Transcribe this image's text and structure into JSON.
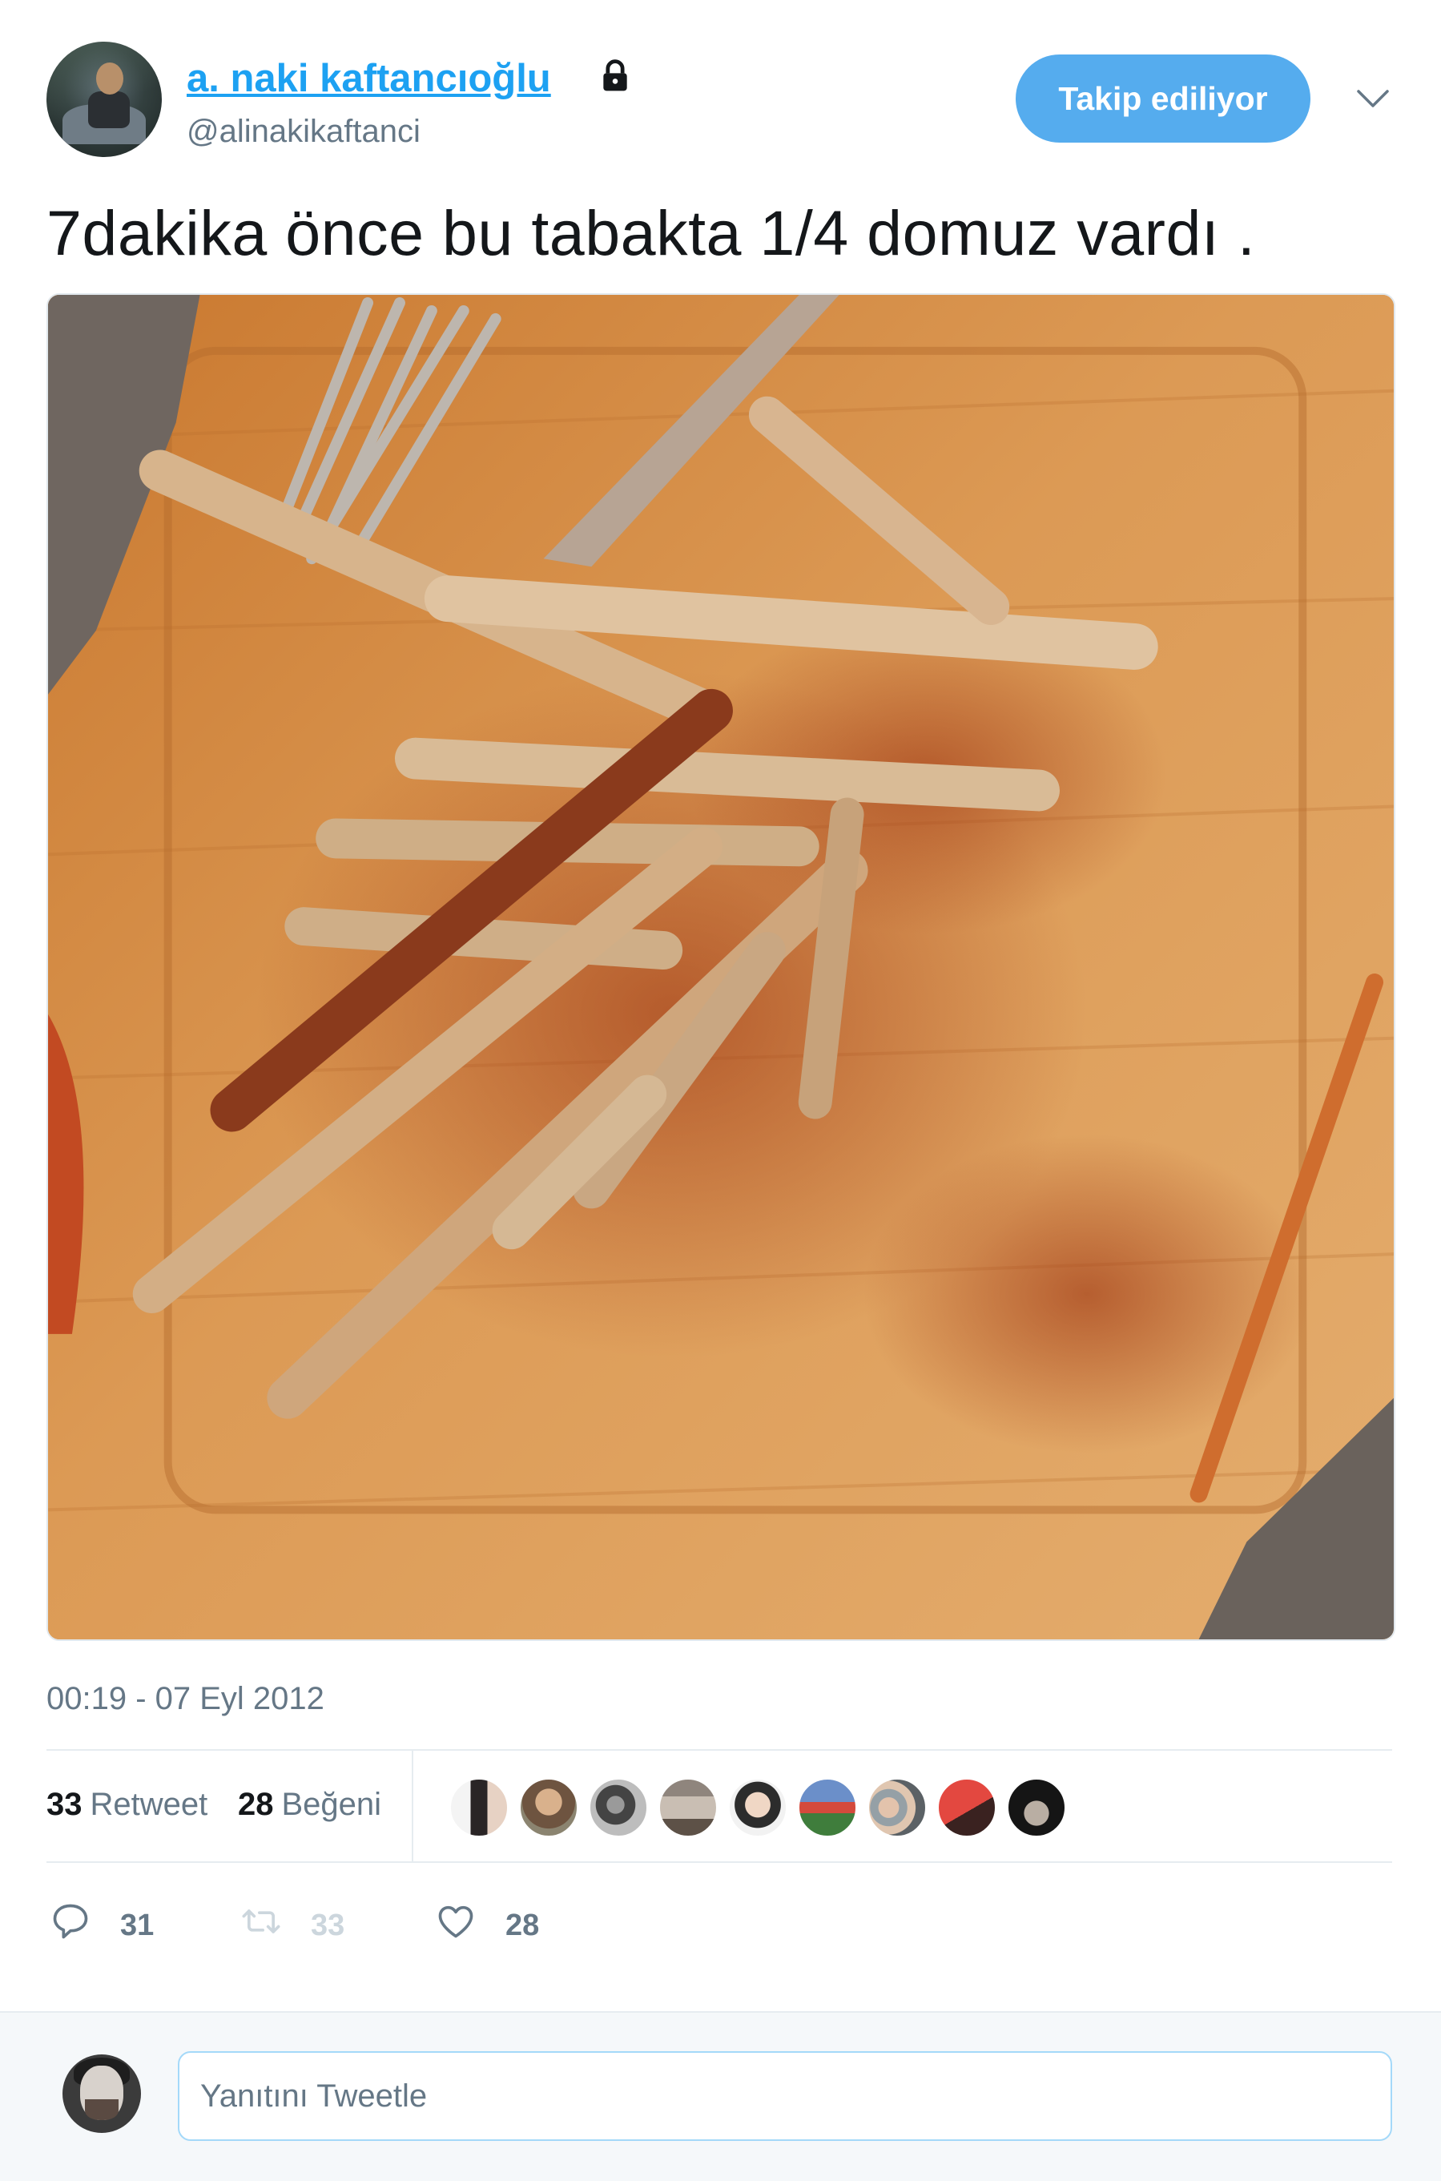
{
  "author": {
    "display_name": "a. naki kaftancıoğlu",
    "handle": "@alinakikaftanci",
    "protected_icon": "lock-icon"
  },
  "follow_button": {
    "label": "Takip ediliyor"
  },
  "more_menu_icon": "chevron-down-icon",
  "tweet": {
    "text": "7dakika önce bu tabakta 1/4 domuz vardı .",
    "timestamp": "00:19 - 07 Eyl 2012"
  },
  "stats": {
    "retweets_count": "33",
    "retweets_label": "Retweet",
    "likes_count": "28",
    "likes_label": "Beğeni",
    "liker_avatar_count": 9
  },
  "actions": {
    "reply": {
      "icon": "reply-icon",
      "count": "31"
    },
    "retweet": {
      "icon": "retweet-icon",
      "count": "33"
    },
    "like": {
      "icon": "heart-icon",
      "count": "28"
    }
  },
  "reply_box": {
    "placeholder": "Yanıtını Tweetle"
  },
  "colors": {
    "accent": "#1da1f2",
    "follow_button_bg": "#55acee",
    "muted_text": "#657786"
  }
}
